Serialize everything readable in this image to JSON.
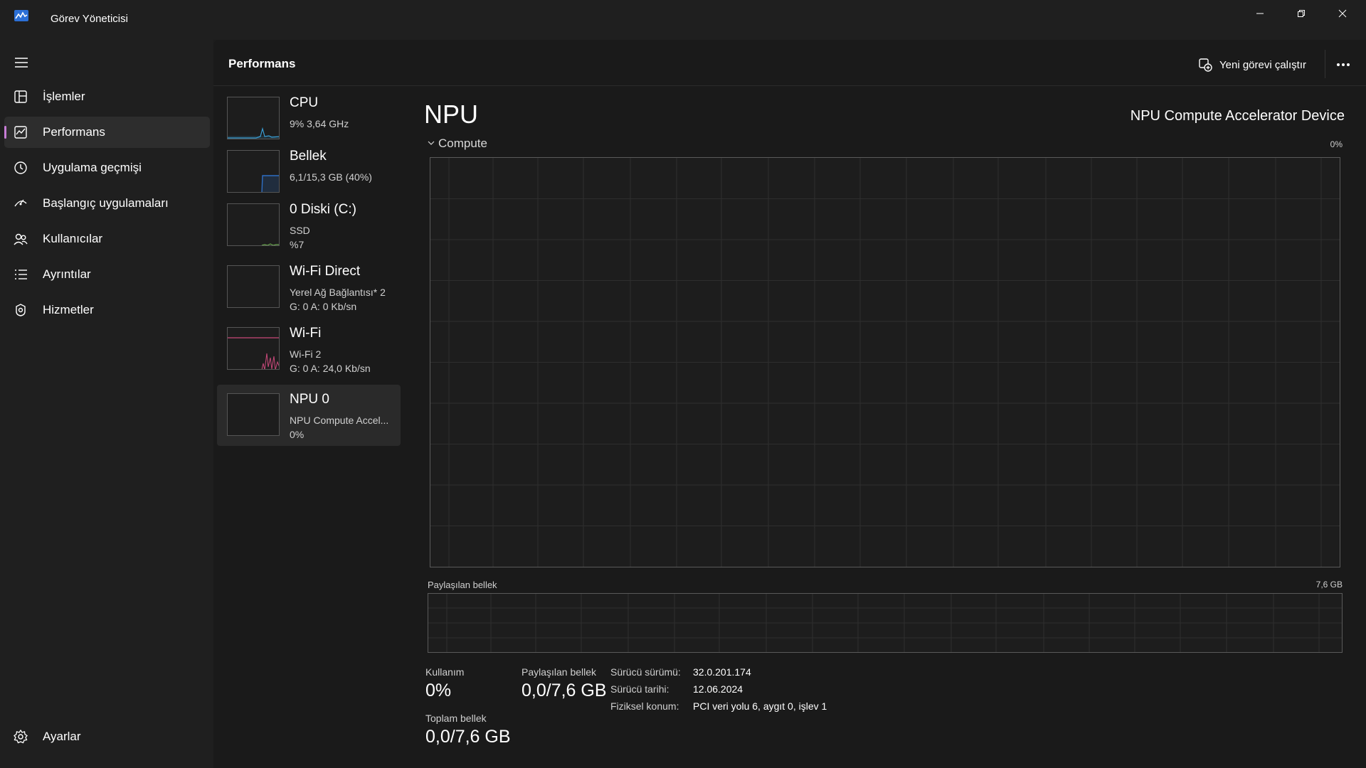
{
  "window": {
    "title": "Görev Yöneticisi",
    "controls": [
      "minimize-icon",
      "restore-icon",
      "close-icon"
    ]
  },
  "sidebar": {
    "items": [
      {
        "label": "İşlemler",
        "icon": "processes-icon"
      },
      {
        "label": "Performans",
        "icon": "performance-icon",
        "active": true
      },
      {
        "label": "Uygulama geçmişi",
        "icon": "history-icon"
      },
      {
        "label": "Başlangıç uygulamaları",
        "icon": "startup-icon"
      },
      {
        "label": "Kullanıcılar",
        "icon": "users-icon"
      },
      {
        "label": "Ayrıntılar",
        "icon": "details-icon"
      },
      {
        "label": "Hizmetler",
        "icon": "services-icon"
      }
    ],
    "settings": {
      "label": "Ayarlar",
      "icon": "settings-icon"
    }
  },
  "header": {
    "title": "Performans",
    "run_task": "Yeni görevi çalıştır",
    "more": "more-icon"
  },
  "resources": [
    {
      "name": "CPU",
      "line1": "9% 3,64 GHz",
      "line2": "",
      "color": "#3aa0d8"
    },
    {
      "name": "Bellek",
      "line1": "6,1/15,3 GB (40%)",
      "line2": "",
      "color": "#2f6fc4"
    },
    {
      "name": "0 Diski (C:)",
      "line1": "SSD",
      "line2": "%7",
      "color": "#6aa84f"
    },
    {
      "name": "Wi-Fi Direct",
      "line1": "Yerel Ağ Bağlantısı* 2",
      "line2": "G: 0 A: 0 Kb/sn",
      "color": "#c8497a"
    },
    {
      "name": "Wi-Fi",
      "line1": "Wi-Fi 2",
      "line2": "G: 0 A: 24,0 Kb/sn",
      "color": "#c8497a"
    },
    {
      "name": "NPU 0",
      "line1": "NPU Compute Accel...",
      "line2": "0%",
      "color": "#888888",
      "active": true
    }
  ],
  "detail": {
    "title": "NPU",
    "device": "NPU Compute Accelerator Device",
    "compute_label": "Compute",
    "compute_max": "0%",
    "shared_label": "Paylaşılan bellek",
    "shared_max": "7,6 GB",
    "stats": {
      "usage_label": "Kullanım",
      "usage_value": "0%",
      "shared_label": "Paylaşılan bellek",
      "shared_value": "0,0/7,6 GB",
      "total_label": "Toplam bellek",
      "total_value": "0,0/7,6 GB"
    },
    "info": [
      {
        "key": "Sürücü sürümü:",
        "value": "32.0.201.174"
      },
      {
        "key": "Sürücü tarihi:",
        "value": "12.06.2024"
      },
      {
        "key": "Fiziksel konum:",
        "value": "PCI veri yolu 6, aygıt 0, işlev 1"
      }
    ]
  }
}
